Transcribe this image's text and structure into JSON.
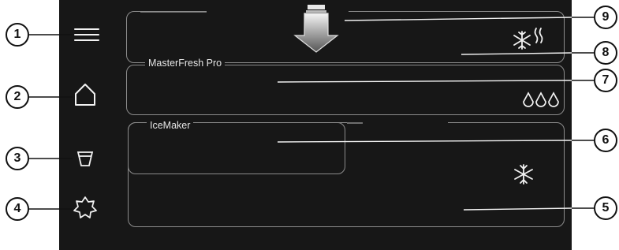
{
  "zones": {
    "freezer_top": {
      "icon": "snowflake-wave-icon"
    },
    "masterfresh": {
      "label": "MasterFresh Pro",
      "icon": "humidity-drops-icon",
      "icon_glyph": "ΔΔΔ"
    },
    "icemaker": {
      "label": "IceMaker"
    },
    "freezer_bottom": {
      "icon": "snowflake-icon"
    }
  },
  "sidebar": {
    "items": [
      {
        "name": "menu-icon"
      },
      {
        "name": "home-icon"
      },
      {
        "name": "drink-cup-icon"
      },
      {
        "name": "star-badge-icon"
      }
    ]
  },
  "callouts": [
    "1",
    "2",
    "3",
    "4",
    "5",
    "6",
    "7",
    "8",
    "9"
  ]
}
